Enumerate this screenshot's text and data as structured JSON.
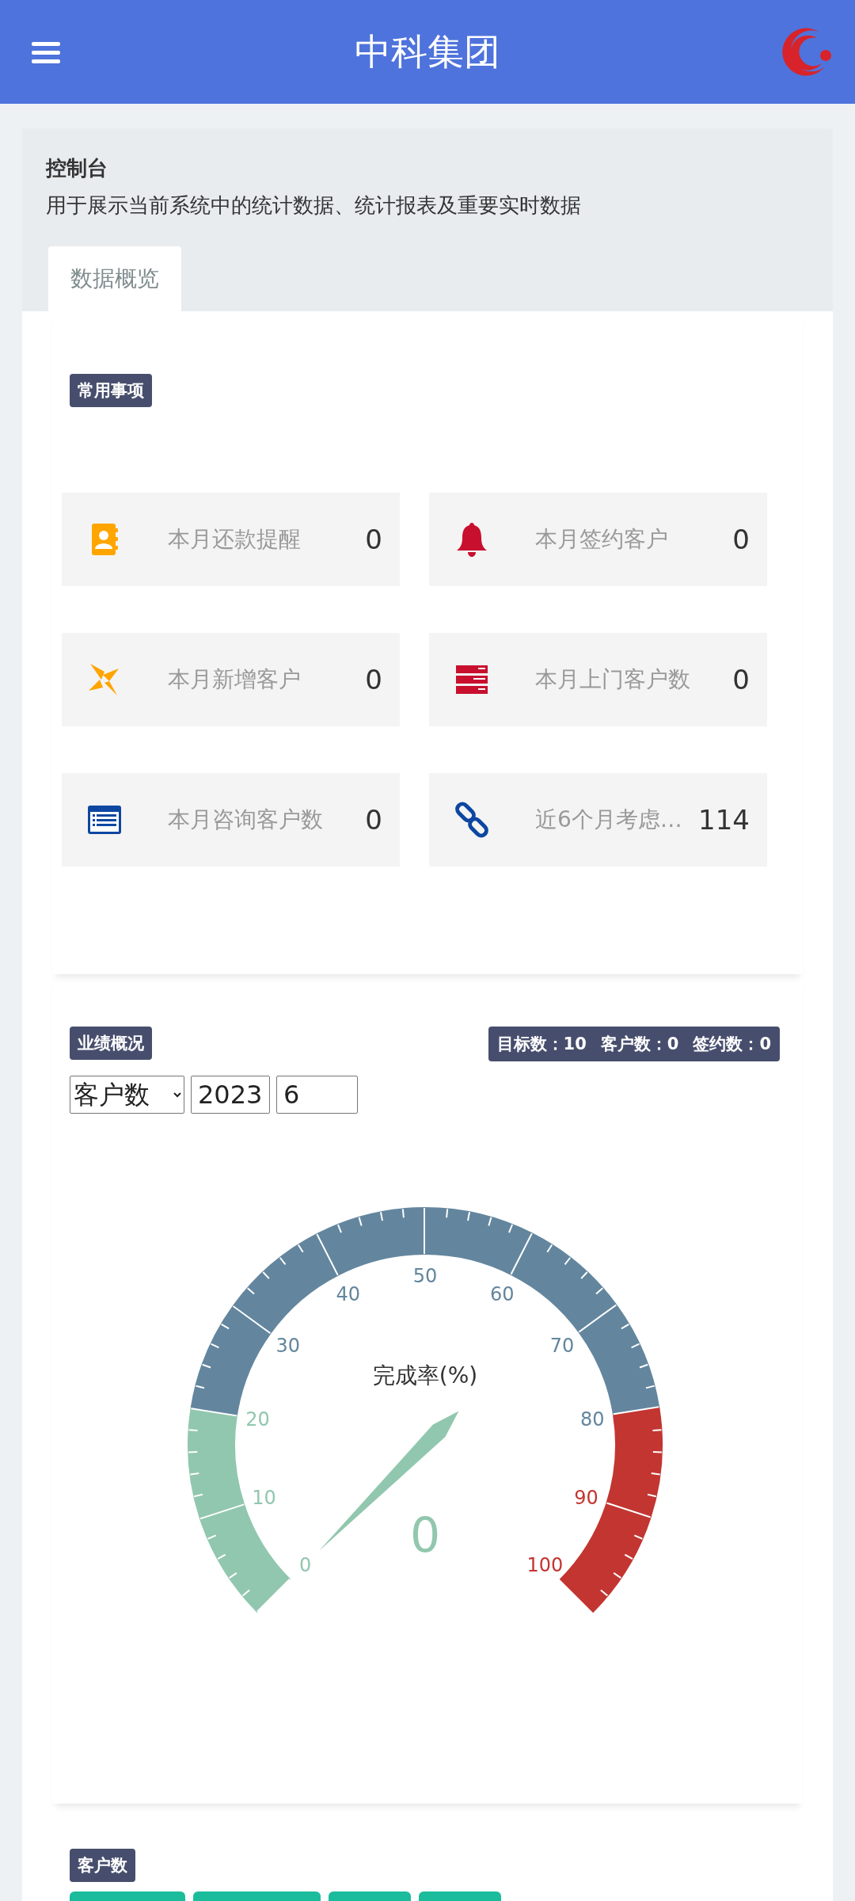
{
  "header": {
    "title": "中科集团"
  },
  "console": {
    "title": "控制台",
    "subtitle": "用于展示当前系统中的统计数据、统计报表及重要实时数据"
  },
  "tabs": [
    {
      "label": "数据概览",
      "selected": true
    }
  ],
  "common": {
    "badge": "常用事项",
    "tiles": [
      {
        "kind": "contacts",
        "label": "本月还款提醒",
        "value": "0"
      },
      {
        "kind": "bell",
        "label": "本月签约客户",
        "value": "0"
      },
      {
        "kind": "pinwheel",
        "label": "本月新增客户",
        "value": "0"
      },
      {
        "kind": "server",
        "label": "本月上门客户数",
        "value": "0"
      },
      {
        "kind": "list",
        "label": "本月咨询客户数",
        "value": "0"
      },
      {
        "kind": "link",
        "label": "近6个月考虑…",
        "value": "114"
      }
    ]
  },
  "performance": {
    "badge": "业绩概况",
    "summary": [
      "目标数：10",
      "客户数：0",
      "签约数：0"
    ],
    "type_select": "客户数",
    "year": "2023",
    "month": "6",
    "gauge": {
      "title": "完成率(%)",
      "value": "0",
      "ticks": [
        {
          "label": "0",
          "color": "#91c7ae"
        },
        {
          "label": "10",
          "color": "#91c7ae"
        },
        {
          "label": "20",
          "color": "#91c7ae"
        },
        {
          "label": "30",
          "color": "#63869e"
        },
        {
          "label": "40",
          "color": "#63869e"
        },
        {
          "label": "50",
          "color": "#63869e"
        },
        {
          "label": "60",
          "color": "#63869e"
        },
        {
          "label": "70",
          "color": "#63869e"
        },
        {
          "label": "80",
          "color": "#63869e"
        },
        {
          "label": "90",
          "color": "#c23531"
        },
        {
          "label": "100",
          "color": "#c23531"
        }
      ]
    }
  },
  "customers": {
    "badge": "客户数",
    "filter_buttons": [
      {
        "kind": "button"
      },
      {
        "kind": "button"
      },
      {
        "kind": "button"
      },
      {
        "kind": "button"
      }
    ]
  }
}
